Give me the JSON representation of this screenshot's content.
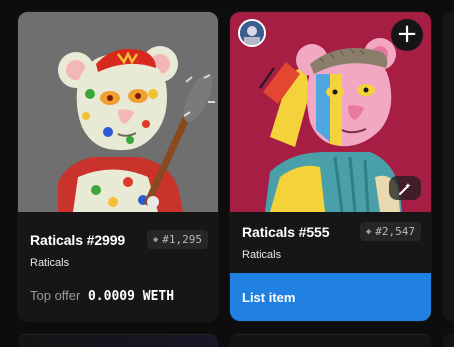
{
  "cards": [
    {
      "name": "Raticals #2999",
      "rank": "#1,295",
      "collection": "Raticals",
      "offer_label": "Top offer",
      "offer_value": "0.0009 WETH",
      "image_icon": "polka-dot-rat-with-bat-artwork"
    },
    {
      "name": "Raticals #555",
      "rank": "#2,547",
      "collection": "Raticals",
      "action_label": "List item",
      "image_icon": "rainbow-rat-with-flat-cap-artwork",
      "add_icon": "plus-icon",
      "magic_icon": "magic-wand-icon",
      "avatar_icon": "owner-avatar"
    }
  ],
  "colors": {
    "card_bg": "#161616",
    "page_bg": "#0d0d0d",
    "accent_blue": "#2081e2",
    "card1_image_bg": "#6f6f6f",
    "card2_image_bg": "#a61e44"
  }
}
